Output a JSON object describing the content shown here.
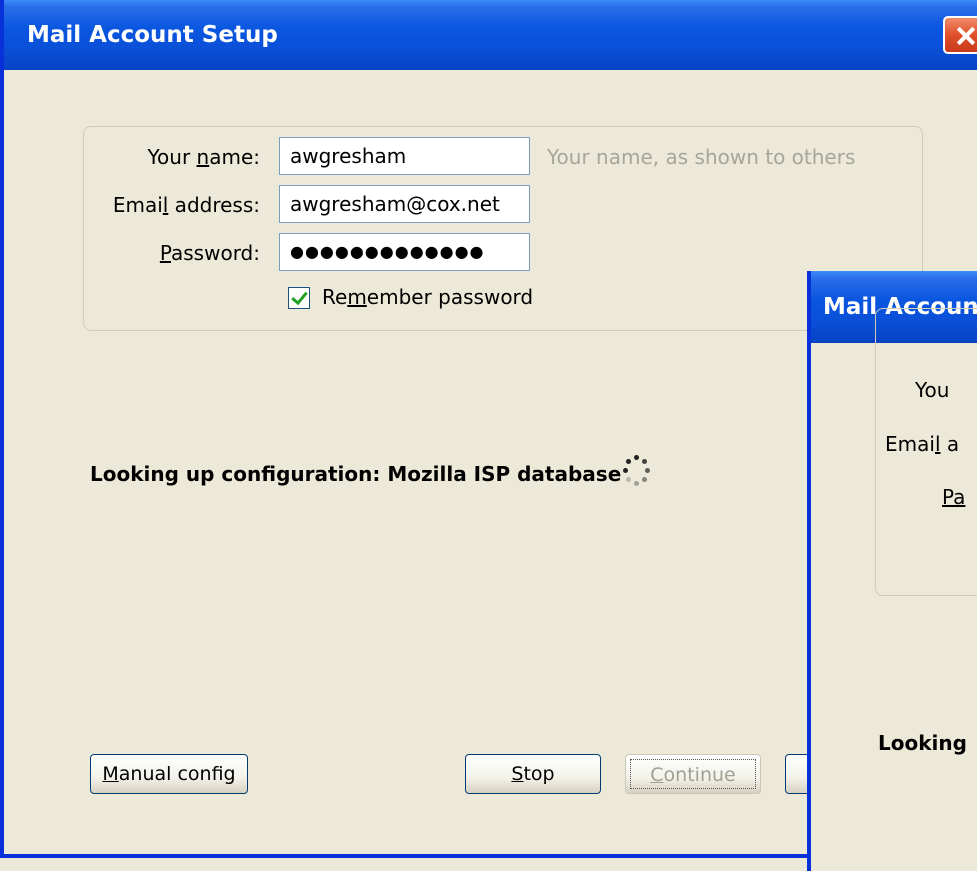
{
  "main_window": {
    "title": "Mail Account Setup",
    "form": {
      "name_label_pre": "Your ",
      "name_label_key": "n",
      "name_label_post": "ame:",
      "name_value": "awgresham",
      "name_hint": "Your name, as shown to others",
      "email_label_pre": "Emai",
      "email_label_key": "l",
      "email_label_post": " address:",
      "email_value": "awgresham@cox.net",
      "password_label_key": "P",
      "password_label_post": "assword:",
      "password_value": "●●●●●●●●●●●●●",
      "remember_pre": "Re",
      "remember_key": "m",
      "remember_post": "ember password",
      "remember_checked": true
    },
    "status_text": "Looking up configuration: Mozilla ISP database",
    "buttons": {
      "manual_key": "M",
      "manual_post": "anual config",
      "stop_key": "S",
      "stop_post": "top",
      "continue_key": "C",
      "continue_post": "ontinue"
    }
  },
  "second_window": {
    "title": "Mail Account",
    "name_label": "You",
    "email_label_pre": "Emai",
    "email_label_key": "l",
    "email_label_post": " a",
    "password_label_key": "Pa",
    "status_text": "Looking"
  },
  "colors": {
    "titlebar": "#0b56e0",
    "dialog_bg": "#ece9d8",
    "check": "#21a121"
  },
  "icons": {
    "close": "close-icon",
    "spinner": "loading-spinner-icon",
    "check": "checkmark-icon"
  }
}
